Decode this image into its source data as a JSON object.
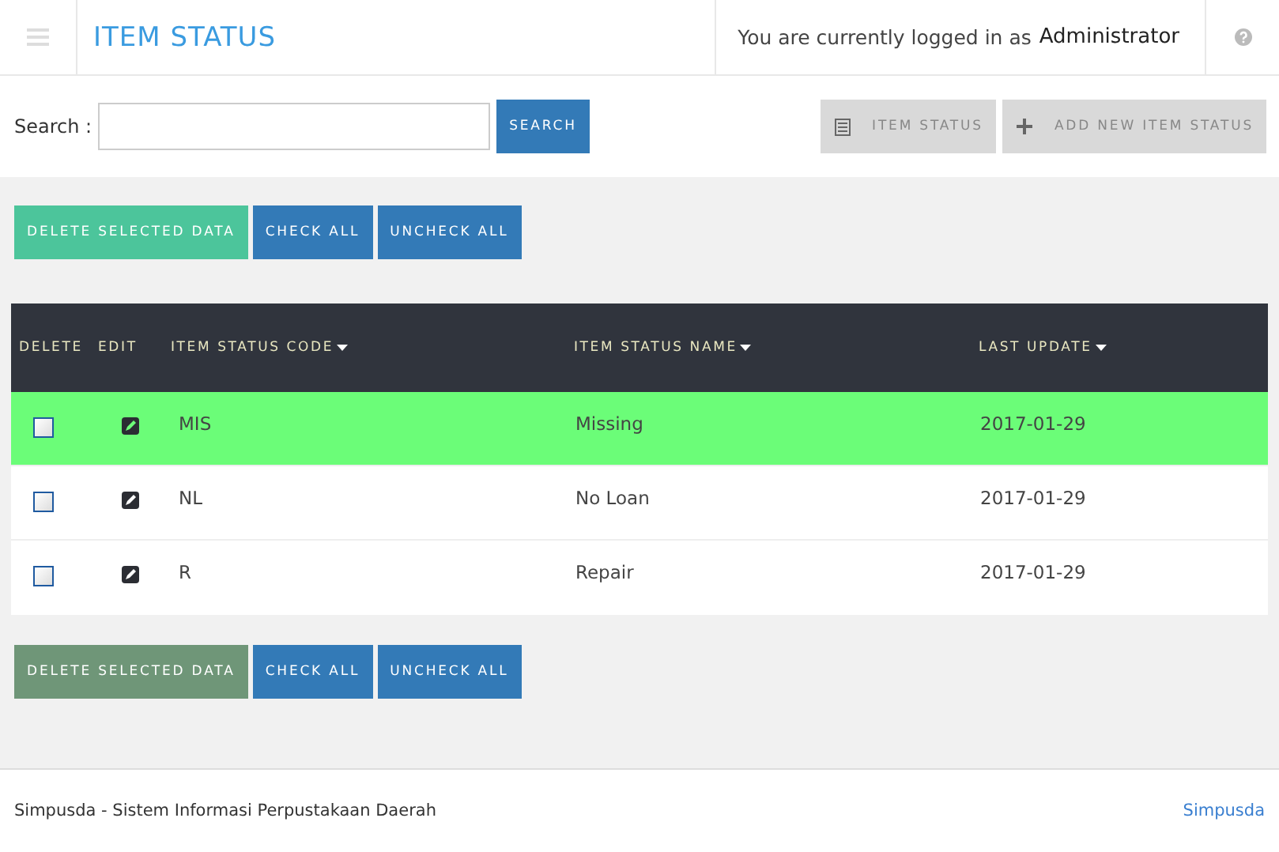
{
  "header": {
    "title": "ITEM STATUS",
    "login_text": "You are currently logged in as",
    "user": "Administrator"
  },
  "search": {
    "label": "Search :",
    "button": "SEARCH"
  },
  "toolbar": [
    {
      "kind": "list",
      "label": "ITEM STATUS"
    },
    {
      "kind": "add",
      "label": "ADD NEW ITEM STATUS"
    }
  ],
  "action_bars": [
    {
      "delete": "DELETE SELECTED DATA",
      "delete_highlighted": true,
      "check_all": "CHECK ALL",
      "uncheck_all": "UNCHECK ALL"
    },
    {
      "delete": "DELETE SELECTED DATA",
      "delete_highlighted": false,
      "check_all": "CHECK ALL",
      "uncheck_all": "UNCHECK ALL"
    }
  ],
  "table": {
    "columns": [
      {
        "label": "DELETE",
        "sortable": false
      },
      {
        "label": "EDIT",
        "sortable": false
      },
      {
        "label": "ITEM STATUS CODE",
        "sortable": true
      },
      {
        "label": "ITEM STATUS NAME",
        "sortable": true
      },
      {
        "label": "LAST UPDATE",
        "sortable": true
      }
    ],
    "rows": [
      {
        "selected": true,
        "checked": false,
        "code": "MIS",
        "name": "Missing",
        "last_update": "2017-01-29"
      },
      {
        "selected": false,
        "checked": false,
        "code": "NL",
        "name": "No Loan",
        "last_update": "2017-01-29"
      },
      {
        "selected": false,
        "checked": false,
        "code": "R",
        "name": "Repair",
        "last_update": "2017-01-29"
      }
    ]
  },
  "footer": {
    "text": "Simpusda - Sistem Informasi Perpustakaan Daerah",
    "link": "Simpusda"
  }
}
